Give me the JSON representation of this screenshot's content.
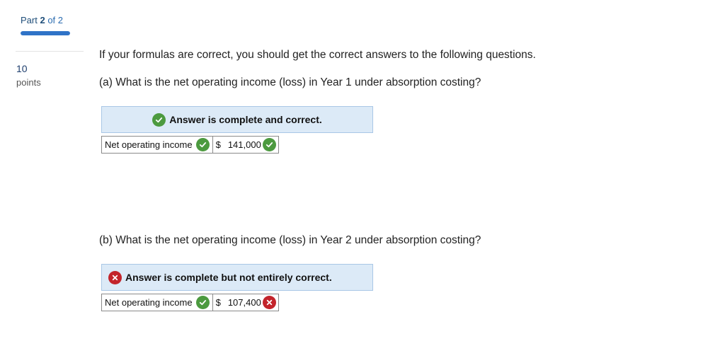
{
  "header": {
    "part_word": "Part",
    "part_number": "2",
    "part_of": "of 2",
    "progress_fraction": 1.0
  },
  "points": {
    "value": "10",
    "label": "points"
  },
  "intro": "If your formulas are correct, you should get the correct answers to the following questions.",
  "questions": [
    {
      "prompt": "(a) What is the net operating income (loss) in Year 1 under absorption costing?",
      "banner": "Answer is complete and correct.",
      "banner_status": "correct",
      "field_label": "Net operating income",
      "currency": "$",
      "amount": "141,000",
      "amount_status": "correct"
    },
    {
      "prompt": "(b) What is the net operating income (loss) in Year 2 under absorption costing?",
      "banner": "Answer is complete but not entirely correct.",
      "banner_status": "incorrect",
      "field_label": "Net operating income",
      "currency": "$",
      "amount": "107,400",
      "amount_status": "incorrect"
    }
  ],
  "colors": {
    "correct": "#4c9a3f",
    "incorrect": "#c3242b",
    "banner_bg": "#dceaf7",
    "accent": "#2f73c7"
  },
  "icons": {
    "correct": "check-circle-icon",
    "incorrect": "x-circle-icon"
  }
}
